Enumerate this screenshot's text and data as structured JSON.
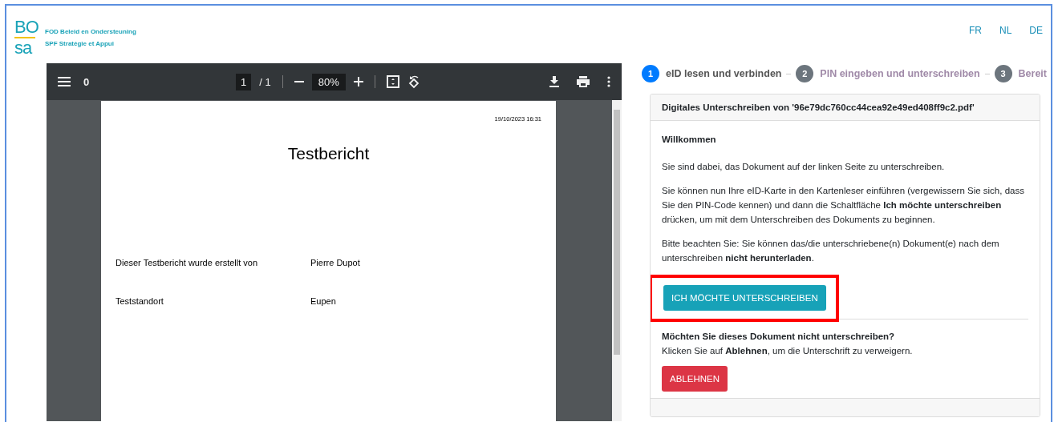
{
  "header": {
    "logo": {
      "top": "BO",
      "bottom": "sa"
    },
    "org_lines": [
      "FOD Beleid en Ondersteuning",
      "SPF Stratégie et Appui"
    ],
    "languages": [
      "FR",
      "NL",
      "DE"
    ]
  },
  "pdf_viewer": {
    "toolbar": {
      "title": "0",
      "page_input": "1",
      "page_total": "/ 1",
      "zoom": "80%"
    },
    "document": {
      "timestamp": "19/10/2023 16:31",
      "title": "Testbericht",
      "rows": [
        {
          "label": "Dieser Testbericht wurde erstellt von",
          "value": "Pierre Dupot"
        },
        {
          "label": "Teststandort",
          "value": "Eupen"
        }
      ]
    }
  },
  "stepper": [
    {
      "number": "1",
      "label": "eID lesen und verbinden",
      "selected": true
    },
    {
      "number": "2",
      "label": "PIN eingeben und unterschreiben",
      "selected": false
    },
    {
      "number": "3",
      "label": "Bereit",
      "selected": false
    }
  ],
  "card": {
    "header": "Digitales Unterschreiben von '96e79dc760cc44cea92e49ed408ff9c2.pdf'",
    "heading": "Willkommen",
    "paragraphs": [
      "Sie sind dabei, das Dokument auf der linken Seite zu unterschreiben.",
      "Sie können nun Ihre eID-Karte in den Kartenleser einführen (vergewissern Sie sich, dass Sie den PIN-Code kennen) und dann die Schaltfläche **Ich möchte unterschreiben** drücken, um mit dem Unterschreiben des Dokuments zu beginnen.",
      "Bitte beachten Sie: Sie können das/die unterschriebene(n) Dokument(e) nach dem unterschreiben **nicht herunterladen**."
    ],
    "sign_button": {
      "label": "ICH MÖCHTE UNTERSCHREIBEN",
      "highlighted": true
    },
    "decline_heading": "Möchten Sie dieses Dokument nicht unterschreiben?",
    "decline_text": "Klicken Sie auf **Ablehnen**, um die Unterschrift zu verweigern.",
    "decline_button": {
      "label": "ABLEHNEN"
    }
  }
}
